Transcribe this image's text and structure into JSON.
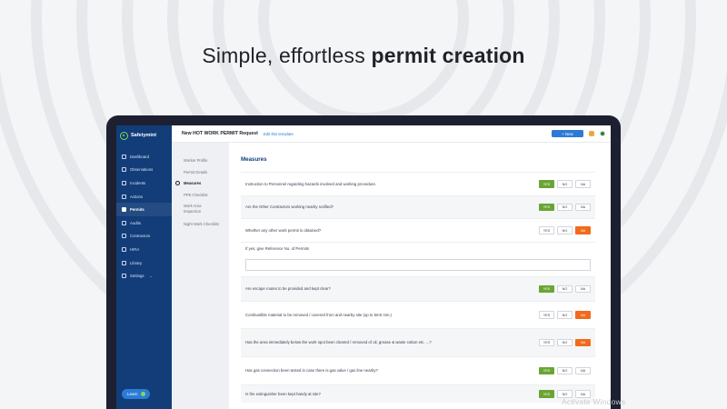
{
  "headline": {
    "prefix": "Simple, effortless",
    "emphasis": "permit creation"
  },
  "colors": {
    "sidebar": "#123d79",
    "accent": "#2d7ad6",
    "yes_selected": "#6aa534",
    "na_selected": "#f26a1b",
    "device_frame": "#1c2030"
  },
  "sidebar": {
    "brand": "Safetymint",
    "items": [
      {
        "label": "Dashboard",
        "icon": "dashboard-icon",
        "active": false
      },
      {
        "label": "Observations",
        "icon": "observations-icon",
        "active": false
      },
      {
        "label": "Incidents",
        "icon": "incidents-icon",
        "active": false
      },
      {
        "label": "Actions",
        "icon": "actions-icon",
        "active": false
      },
      {
        "label": "Permits",
        "icon": "permits-icon",
        "active": true
      },
      {
        "label": "Audits",
        "icon": "audits-icon",
        "active": false
      },
      {
        "label": "Contractors",
        "icon": "contractors-icon",
        "active": false
      },
      {
        "label": "HIRA",
        "icon": "hira-icon",
        "active": false
      },
      {
        "label": "Library",
        "icon": "library-icon",
        "active": false
      },
      {
        "label": "Settings",
        "icon": "settings-icon",
        "active": false
      }
    ],
    "learn_label": "Learn"
  },
  "topbar": {
    "title": "New HOT WORK PERMIT Request",
    "edit_link": "Edit this template",
    "new_button": "+ New"
  },
  "steps": [
    {
      "label": "Worker Profile",
      "active": false
    },
    {
      "label": "Permit Details",
      "active": false
    },
    {
      "label": "Measures",
      "active": true
    },
    {
      "label": "PPE Checklist",
      "active": false
    },
    {
      "label": "Work Area Inspection",
      "active": false
    },
    {
      "label": "Night Work Checklist",
      "active": false
    }
  ],
  "form": {
    "title": "Measures",
    "option_labels": {
      "yes": "YES",
      "no": "NO",
      "na": "NA"
    },
    "reference_label": "If yes, give Reference No. of Permits",
    "reference_value": "",
    "questions": [
      {
        "text": "Instruction to Personnel regarding hazards involved and working procedure.",
        "selected": "yes"
      },
      {
        "text": "Are the Other Contractors working nearby notified?",
        "selected": "yes"
      },
      {
        "text": "Whether any other work permit is obtained?",
        "selected": "na"
      },
      {
        "text": "Are escape routes to be provided and kept clear?",
        "selected": "yes"
      },
      {
        "text": "Combustible material to be removed / covered from and nearby site (up to 5mtr min.)",
        "selected": "na"
      },
      {
        "text": "Has the area immediately below the work spot been cleared / removed of oil, grease & waste cotton etc. ...?",
        "selected": "na"
      },
      {
        "text": "Has gas connection been tested in case there is gas valve / gas line nearby?",
        "selected": "yes"
      },
      {
        "text": "Is fire extinguisher been kept handy at site?",
        "selected": "yes"
      }
    ]
  },
  "watermark": "Activate Windows"
}
